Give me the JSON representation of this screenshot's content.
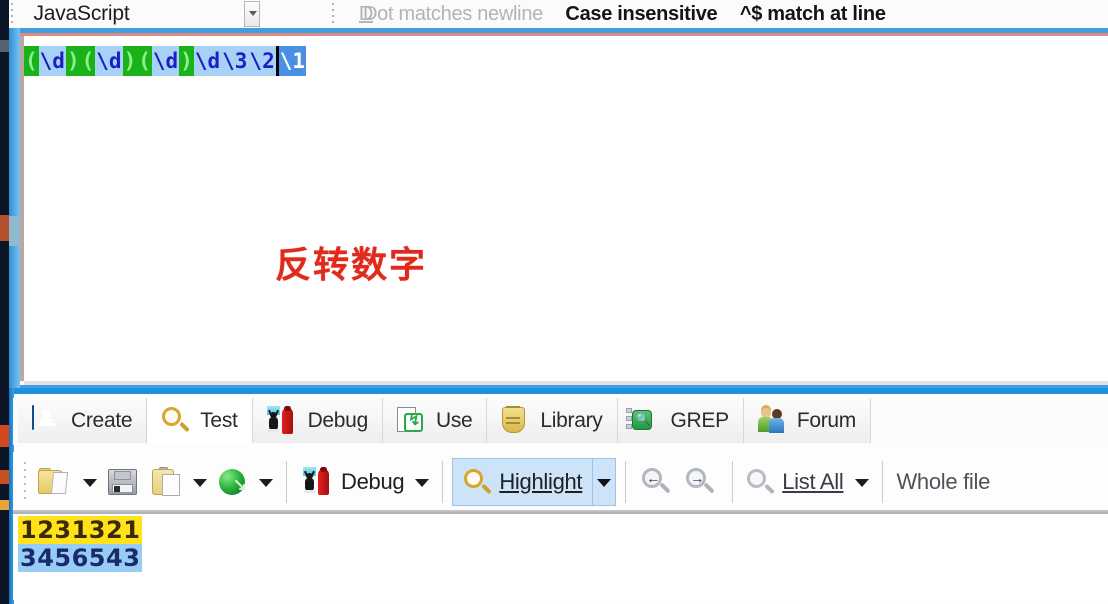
{
  "app": {
    "name": "RegexBuddy",
    "accent_blue": "#2a8ad6",
    "highlight_yellow": "#ffe21a",
    "highlight_blue": "#96cdf5",
    "annotation_red": "#e02a1c"
  },
  "topbar": {
    "flavor_label": "JavaScript",
    "flavor_dropdown_icon": "chevron-down-icon",
    "options": [
      {
        "label": "Dot matches newline",
        "enabled": false,
        "accesskey": "D"
      },
      {
        "label": "Case insensitive",
        "enabled": true,
        "accesskey": "v"
      },
      {
        "label": "^$ match at line",
        "enabled": true,
        "accesskey": ""
      }
    ]
  },
  "regex_editor": {
    "pattern": "(\\d)(\\d)(\\d)\\d\\3\\2\\1",
    "tokens": [
      {
        "text": "(",
        "kind": "group"
      },
      {
        "text": "\\d",
        "kind": "digit"
      },
      {
        "text": ")",
        "kind": "group"
      },
      {
        "text": "(",
        "kind": "group"
      },
      {
        "text": "\\d",
        "kind": "digit"
      },
      {
        "text": ")",
        "kind": "group"
      },
      {
        "text": "(",
        "kind": "group"
      },
      {
        "text": "\\d",
        "kind": "digit"
      },
      {
        "text": ")",
        "kind": "group"
      },
      {
        "text": "\\d",
        "kind": "digit"
      },
      {
        "text": "\\3",
        "kind": "digit"
      },
      {
        "text": "\\2",
        "kind": "digit"
      },
      {
        "text": "\\1",
        "kind": "selected"
      }
    ],
    "caret_before": "\\1",
    "annotation": "反转数字"
  },
  "tabs": [
    {
      "label": "Create",
      "icon": "create-icon",
      "active": false
    },
    {
      "label": "Test",
      "icon": "magnifier-icon",
      "active": true
    },
    {
      "label": "Debug",
      "icon": "bug-icon",
      "active": false
    },
    {
      "label": "Use",
      "icon": "page-arrow-icon",
      "active": false
    },
    {
      "label": "Library",
      "icon": "book-icon",
      "active": false
    },
    {
      "label": "GREP",
      "icon": "grep-icon",
      "active": false
    },
    {
      "label": "Forum",
      "icon": "people-icon",
      "active": false
    }
  ],
  "toolbar": {
    "open_icon": "folder-open-icon",
    "save_icon": "floppy-save-icon",
    "paste_icon": "clipboard-paste-icon",
    "browser_icon": "globe-icon",
    "debug_label": "Debug",
    "debug_accesskey": "g",
    "highlight_label": "Highlight",
    "highlight_accesskey": "H",
    "highlight_pressed": true,
    "find_prev_icon": "find-previous-icon",
    "find_next_icon": "find-next-icon",
    "list_all_label": "List All",
    "list_all_accesskey": "L",
    "scope_label": "Whole file"
  },
  "test_subject": {
    "lines": [
      {
        "text": "1231321",
        "highlight": "yellow"
      },
      {
        "text": "3456543",
        "highlight": "blue"
      }
    ]
  }
}
